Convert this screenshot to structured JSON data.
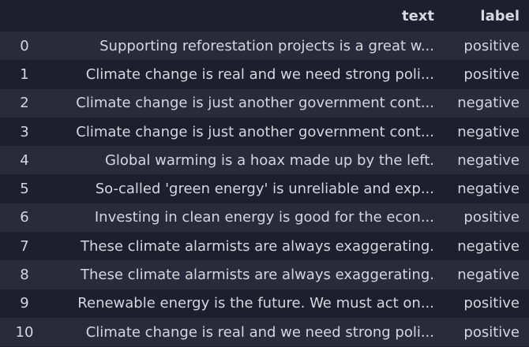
{
  "table": {
    "columns": [
      "",
      "text",
      "label"
    ],
    "rows": [
      {
        "index": "0",
        "text": "Supporting reforestation projects is a great w...",
        "label": "positive"
      },
      {
        "index": "1",
        "text": "Climate change is real and we need strong poli...",
        "label": "positive"
      },
      {
        "index": "2",
        "text": "Climate change is just another government cont...",
        "label": "negative"
      },
      {
        "index": "3",
        "text": "Climate change is just another government cont...",
        "label": "negative"
      },
      {
        "index": "4",
        "text": "Global warming is a hoax made up by the left.",
        "label": "negative"
      },
      {
        "index": "5",
        "text": "So-called 'green energy' is unreliable and exp...",
        "label": "negative"
      },
      {
        "index": "6",
        "text": "Investing in clean energy is good for the econ...",
        "label": "positive"
      },
      {
        "index": "7",
        "text": "These climate alarmists are always exaggerating.",
        "label": "negative"
      },
      {
        "index": "8",
        "text": "These climate alarmists are always exaggerating.",
        "label": "negative"
      },
      {
        "index": "9",
        "text": "Renewable energy is the future. We must act on...",
        "label": "positive"
      },
      {
        "index": "10",
        "text": "Climate change is real and we need strong poli...",
        "label": "positive"
      }
    ]
  }
}
